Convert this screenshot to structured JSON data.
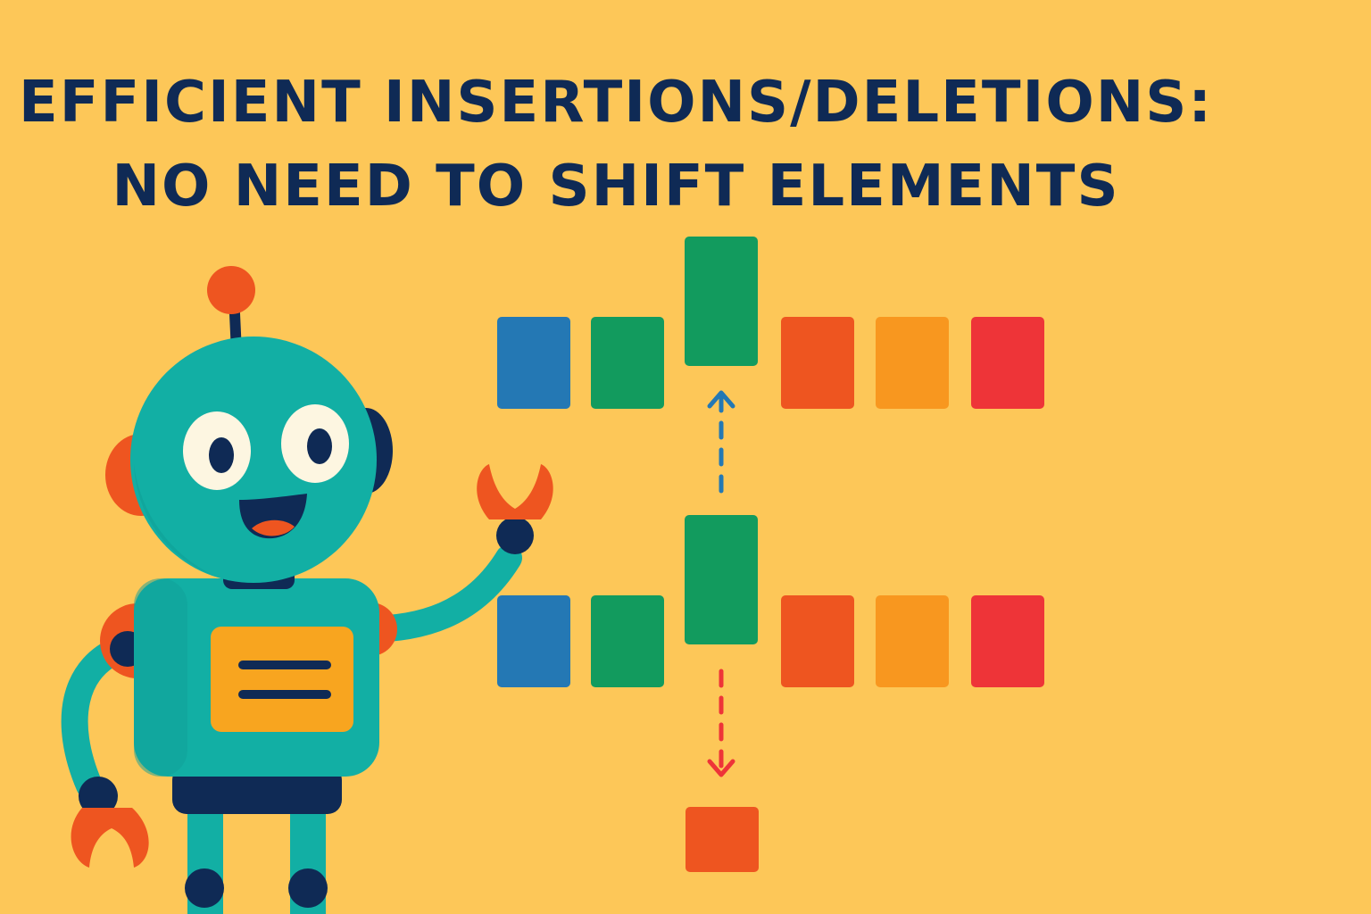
{
  "title": {
    "line1": "EFFICIENT INSERTIONS/DELETIONS:",
    "line2": "NO NEED TO SHIFT ELEMENTS"
  },
  "colors": {
    "background": "#FDC758",
    "title_text": "#0F2A55",
    "blue": "#2478B4",
    "green": "#129B5E",
    "orange_red": "#EE5520",
    "orange": "#F8971F",
    "red": "#EE3438",
    "insert_arrow": "#2478B4",
    "delete_arrow": "#EE3438",
    "robot_body": "#12AFA4",
    "robot_accent": "#EE5520",
    "robot_dark": "#0F2A55",
    "robot_panel": "#F8A51F",
    "robot_eye": "#FDF6E1"
  },
  "diagram": {
    "insertion_row": {
      "blocks": [
        "blue",
        "green",
        "green-raised",
        "orange_red",
        "orange",
        "red"
      ],
      "arrow": "up"
    },
    "deletion_row": {
      "blocks": [
        "blue",
        "green",
        "green-raised",
        "orange_red",
        "orange",
        "red"
      ],
      "arrow": "down",
      "removed_block": "orange_red"
    }
  },
  "robot": {
    "icon": "robot-mascot-icon",
    "pose": "waving"
  }
}
